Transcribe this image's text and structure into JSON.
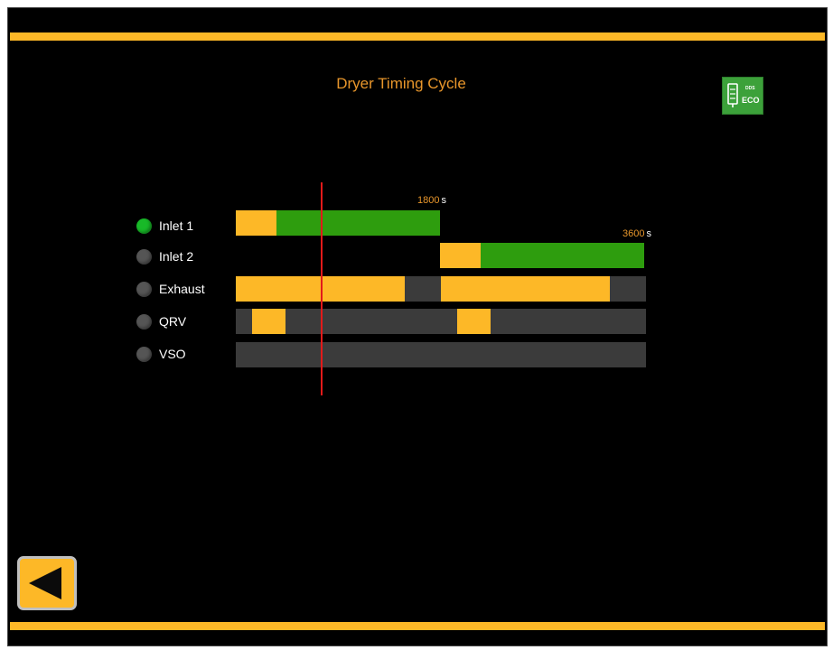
{
  "title": "Dryer Timing Cycle",
  "eco_badge": {
    "top_text": "DDS",
    "label": "ECO"
  },
  "time_markers": [
    {
      "value": "1800",
      "unit": "s"
    },
    {
      "value": "3600",
      "unit": "s"
    }
  ],
  "rows": [
    {
      "label": "Inlet 1",
      "indicator": "on"
    },
    {
      "label": "Inlet 2",
      "indicator": "off"
    },
    {
      "label": "Exhaust",
      "indicator": "off"
    },
    {
      "label": "QRV",
      "indicator": "off"
    },
    {
      "label": "VSO",
      "indicator": "off"
    }
  ],
  "colors": {
    "accent": "#FDB827",
    "active_green": "#2E9D0E",
    "indicator_on": "#18B928",
    "indicator_off": "#555555",
    "cursor": "#E21A1A",
    "title": "#E8962B"
  },
  "icons": {
    "back": "back-arrow-icon",
    "eco": "eco-dryer-icon"
  }
}
